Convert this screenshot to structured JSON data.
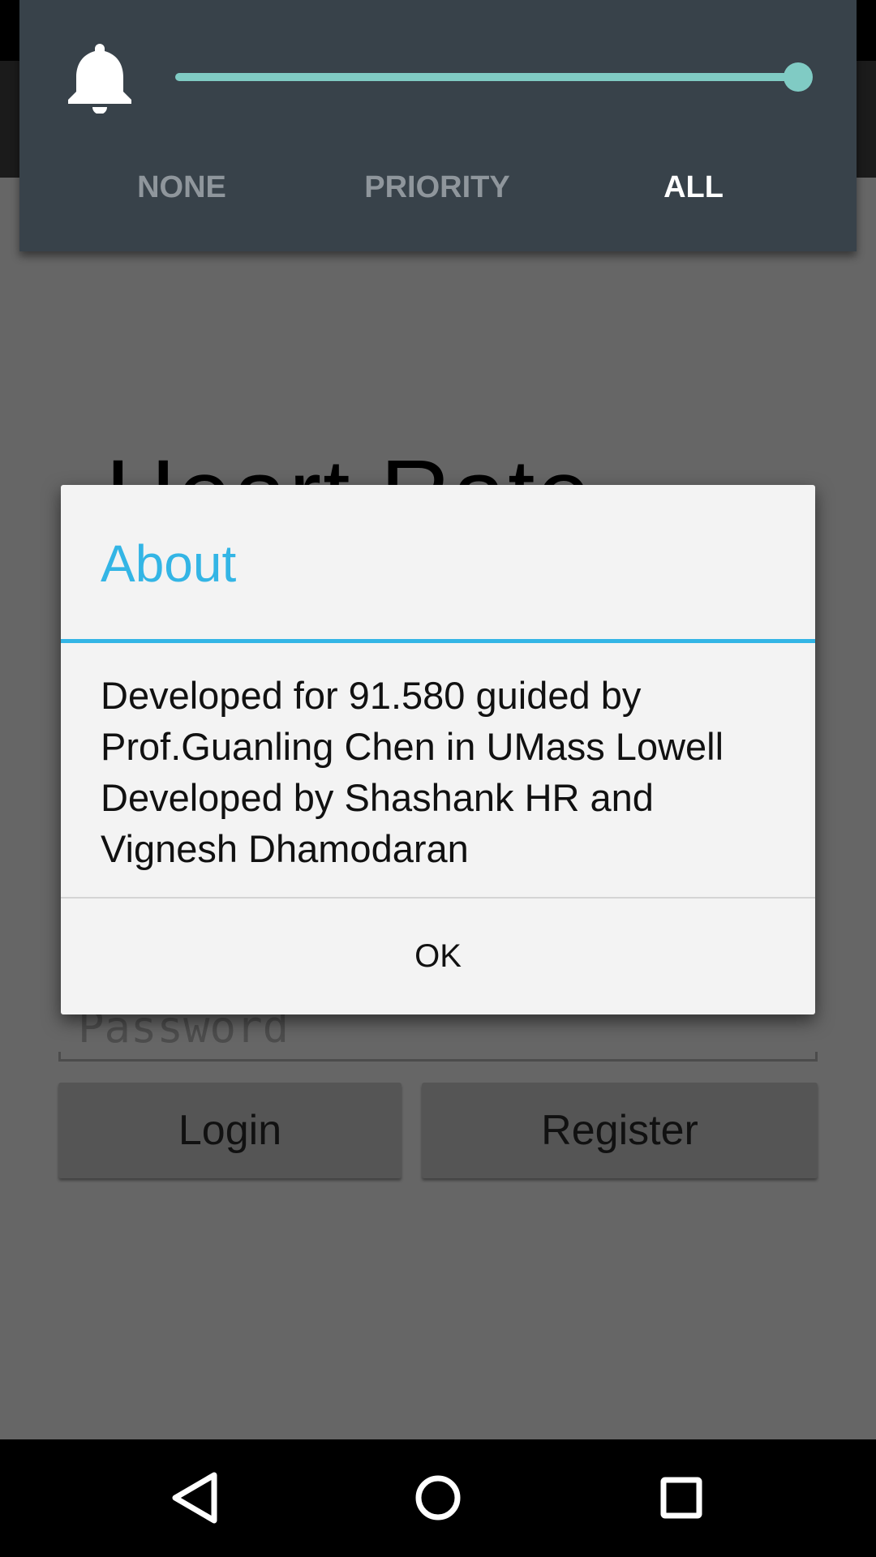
{
  "app": {
    "heading_peek": "Heart Rate",
    "password_placeholder": "Password",
    "login_label": "Login",
    "register_label": "Register"
  },
  "volume_panel": {
    "modes": [
      "NONE",
      "PRIORITY",
      "ALL"
    ],
    "selected_mode": "ALL",
    "slider_level": 1.0,
    "accent_color": "#80cbc4",
    "background_color": "#38424a"
  },
  "dialog": {
    "title": "About",
    "message": "Developed for 91.580 guided by Prof.Guanling Chen in UMass Lowell Developed by Shashank HR and Vignesh Dhamodaran",
    "ok_label": "OK",
    "accent_color": "#33b5e5"
  },
  "nav": {
    "icons": [
      "back-icon",
      "home-icon",
      "recents-icon"
    ]
  }
}
